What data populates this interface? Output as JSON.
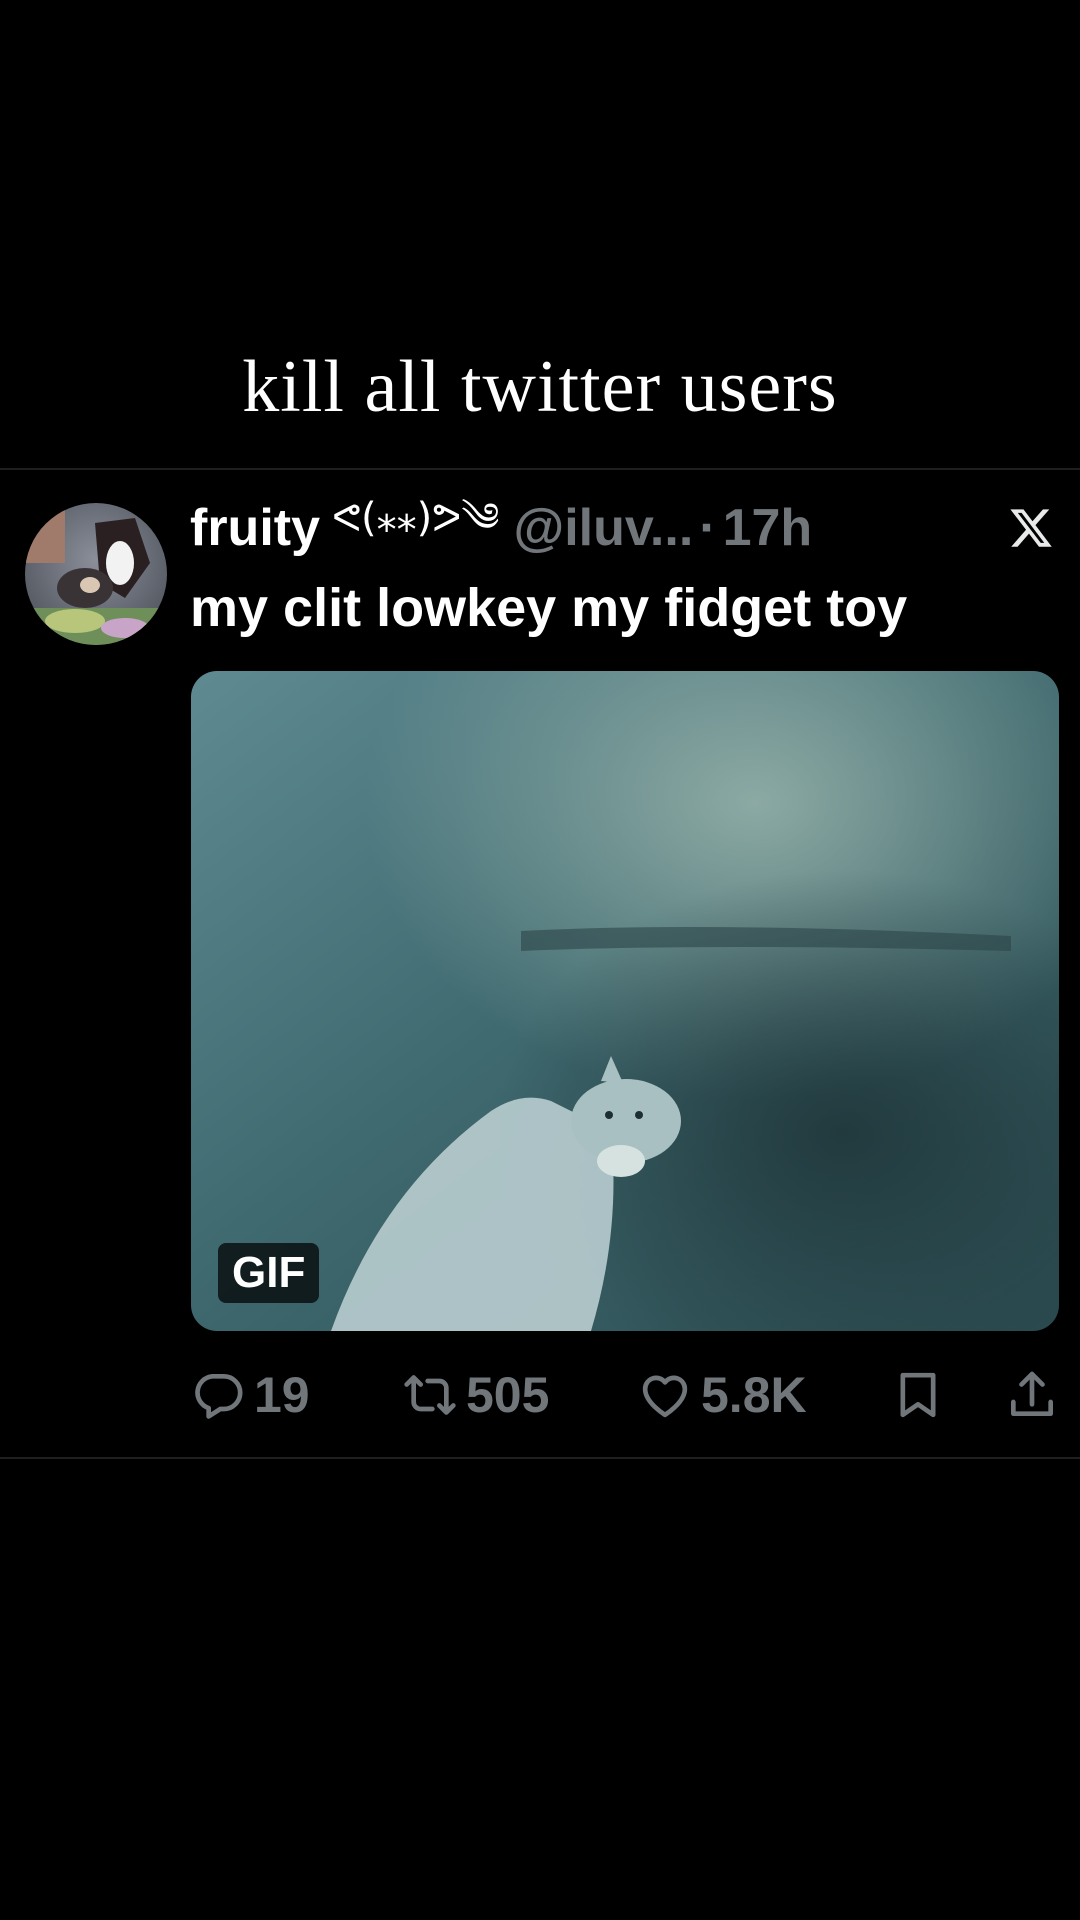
{
  "caption": "kill all twitter users",
  "tweet": {
    "display_name": "fruity",
    "name_emoji": "ᕙ(⁎⁎)ᕗ༄",
    "handle": "@iluv...",
    "separator": "·",
    "time": "17h",
    "text": "my clit lowkey my fidget toy",
    "media_badge": "GIF"
  },
  "actions": {
    "reply_count": "19",
    "retweet_count": "505",
    "like_count": "5.8K"
  },
  "icons": {
    "brand": "x-logo",
    "reply": "reply-icon",
    "retweet": "retweet-icon",
    "like": "heart-icon",
    "bookmark": "bookmark-icon",
    "share": "share-icon"
  },
  "colors": {
    "background": "#000000",
    "primary_text": "#ffffff",
    "secondary_text": "#71767b",
    "divider": "#1f1f1f"
  }
}
